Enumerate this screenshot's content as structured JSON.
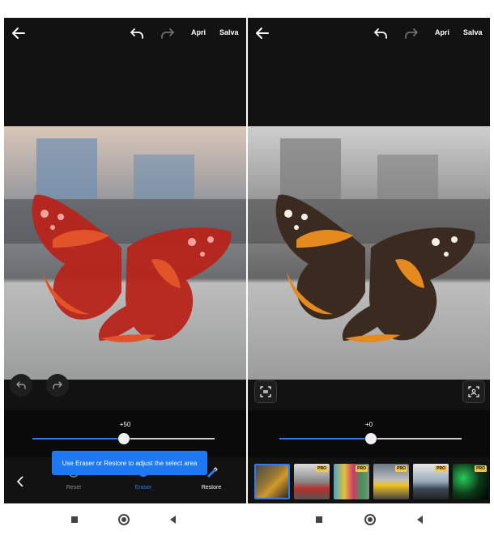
{
  "left_screen": {
    "header": {
      "open_label": "Apri",
      "save_label": "Salva"
    },
    "slider_value": "+50",
    "slider_level_fraction": 0.5,
    "toast_text": "Use Eraser or Restore to adjust the select area",
    "tools": [
      {
        "label": "Reset",
        "icon": "reset-icon"
      },
      {
        "label": "Eraser",
        "icon": "eraser-icon"
      },
      {
        "label": "Restore",
        "icon": "restore-icon"
      }
    ]
  },
  "right_screen": {
    "header": {
      "open_label": "Apri",
      "save_label": "Salva"
    },
    "slider_value": "+0",
    "slider_level_fraction": 0.5,
    "filters": [
      {
        "name": "filter-thumb-1",
        "pro": "",
        "selected": true
      },
      {
        "name": "filter-thumb-2",
        "pro": "PRO",
        "selected": false
      },
      {
        "name": "filter-thumb-3",
        "pro": "PRO",
        "selected": false
      },
      {
        "name": "filter-thumb-4",
        "pro": "PRO",
        "selected": false
      },
      {
        "name": "filter-thumb-5",
        "pro": "PRO",
        "selected": false
      },
      {
        "name": "filter-thumb-6",
        "pro": "PRO",
        "selected": false
      }
    ]
  },
  "colors": {
    "accent": "#2f7bf4",
    "mask": "#c0281c",
    "background": "#121212"
  }
}
